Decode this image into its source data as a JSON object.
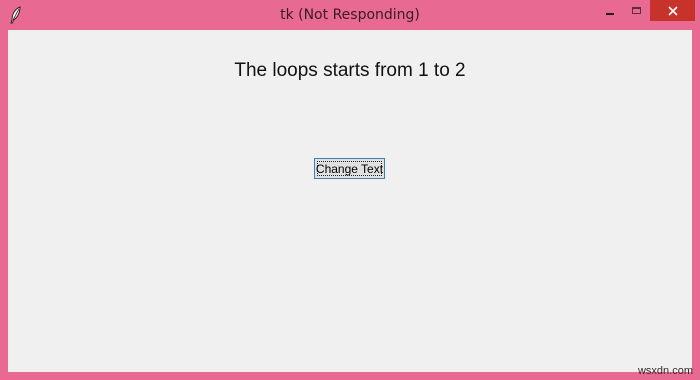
{
  "window": {
    "title": "tk (Not Responding)",
    "icon": "feather-icon",
    "controls": {
      "minimize_icon": "minimize-icon",
      "maximize_icon": "maximize-icon",
      "close_icon": "close-icon"
    },
    "frame_color": "#e86a92",
    "close_color": "#c7332b"
  },
  "content": {
    "label_text": "The loops starts from 1 to 2",
    "button_label": "Change Text",
    "background_color": "#f0f0f0"
  },
  "watermark": "wsxdn.com"
}
